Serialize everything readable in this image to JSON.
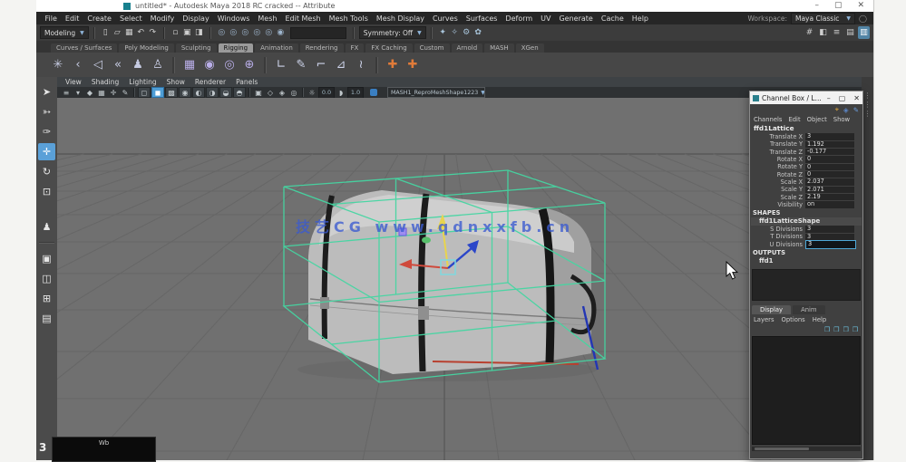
{
  "colors": {
    "lattice": "#45d6a2",
    "axis_x": "#cf4a3c",
    "axis_y": "#e8d44d",
    "axis_z": "#2b46c9",
    "watermark": "#3b5bd1",
    "accent": "#5285a6",
    "viewport_bg": "#707070"
  },
  "titlebar": {
    "title": "untitled* - Autodesk Maya 2018 RC cracked -- Attribute",
    "minimize": "–",
    "maximize": "▢",
    "close": "✕"
  },
  "menubar": {
    "items": [
      "File",
      "Edit",
      "Create",
      "Select",
      "Modify",
      "Display",
      "Windows",
      "Mesh",
      "Edit Mesh",
      "Mesh Tools",
      "Mesh Display",
      "Curves",
      "Surfaces",
      "Deform",
      "UV",
      "Generate",
      "Cache",
      "Help"
    ],
    "workspace_label": "Workspace:",
    "workspace_value": "Maya Classic"
  },
  "statusline": {
    "menuset": "Modeling",
    "file_icons": [
      {
        "name": "new-scene-icon",
        "glyph": "▯"
      },
      {
        "name": "open-scene-icon",
        "glyph": "▱"
      },
      {
        "name": "save-scene-icon",
        "glyph": "▦"
      },
      {
        "name": "undo-icon",
        "glyph": "↶"
      },
      {
        "name": "redo-icon",
        "glyph": "↷"
      }
    ],
    "mask_icons": [
      {
        "name": "select-hierarchy-icon",
        "glyph": "▫"
      },
      {
        "name": "select-object-icon",
        "glyph": "▣"
      },
      {
        "name": "select-component-icon",
        "glyph": "◨"
      }
    ],
    "snap_icons": [
      {
        "name": "snap-to-grid-icon",
        "glyph": "◎",
        "color": "#9fb6ce"
      },
      {
        "name": "snap-to-curve-icon",
        "glyph": "◎",
        "color": "#9fb6ce"
      },
      {
        "name": "snap-to-point-icon",
        "glyph": "◎",
        "color": "#9fb6ce"
      },
      {
        "name": "snap-to-center-icon",
        "glyph": "◎",
        "color": "#9fb6ce"
      },
      {
        "name": "snap-to-viewplane-icon",
        "glyph": "◎",
        "color": "#9fb6ce"
      },
      {
        "name": "make-live-icon",
        "glyph": "◉",
        "color": "#9fb6ce"
      }
    ],
    "symmetry": "Symmetry: Off",
    "render_icons": [
      {
        "name": "render-current-frame-icon",
        "glyph": "✦",
        "color": "#a8c4da"
      },
      {
        "name": "ipr-render-icon",
        "glyph": "✧",
        "color": "#a8c4da"
      },
      {
        "name": "render-settings-icon",
        "glyph": "⚙",
        "color": "#a8c4da"
      },
      {
        "name": "paint-effects-icon",
        "glyph": "✿",
        "color": "#a8c4da"
      }
    ],
    "right_icons": [
      {
        "name": "grid-toggle-icon",
        "glyph": "#"
      },
      {
        "name": "modeling-toolkit-icon",
        "glyph": "◧"
      },
      {
        "name": "hypershade-icon",
        "glyph": "≡"
      },
      {
        "name": "attribute-editor-icon",
        "glyph": "▤"
      },
      {
        "name": "channel-box-icon",
        "glyph": "▥",
        "active": true
      }
    ]
  },
  "shelf": {
    "tabs": [
      {
        "label": "Curves / Surfaces"
      },
      {
        "label": "Poly Modeling"
      },
      {
        "label": "Sculpting"
      },
      {
        "label": "Rigging",
        "active": true
      },
      {
        "label": "Animation"
      },
      {
        "label": "Rendering"
      },
      {
        "label": "FX"
      },
      {
        "label": "FX Caching"
      },
      {
        "label": "Custom"
      },
      {
        "label": "Arnold"
      },
      {
        "label": "MASH"
      },
      {
        "label": "XGen"
      }
    ],
    "icons": [
      {
        "name": "create-joint-icon",
        "glyph": "✳"
      },
      {
        "name": "ik-handle-icon",
        "glyph": "‹"
      },
      {
        "name": "ik-spline-icon",
        "glyph": "◁"
      },
      {
        "name": "insert-joint-icon",
        "glyph": "«"
      },
      {
        "name": "bind-skin-icon",
        "glyph": "♟"
      },
      {
        "name": "interactive-bind-icon",
        "glyph": "♙"
      },
      {
        "sep": true
      },
      {
        "name": "lattice-deformer-icon",
        "glyph": "▦",
        "color": "#b9aee8"
      },
      {
        "name": "cluster-deformer-icon",
        "glyph": "◉",
        "color": "#b9aee8"
      },
      {
        "name": "sculpt-deformer-icon",
        "glyph": "◎",
        "color": "#b9aee8"
      },
      {
        "name": "wrap-deformer-icon",
        "glyph": "⊕",
        "color": "#b9aee8"
      },
      {
        "sep": true
      },
      {
        "name": "edit-curve-icon",
        "glyph": "∟",
        "color": "#cdd3ea"
      },
      {
        "name": "pencil-curve-icon",
        "glyph": "✎",
        "color": "#cdd3ea"
      },
      {
        "name": "attach-curve-icon",
        "glyph": "⌐",
        "color": "#cdd3ea"
      },
      {
        "name": "detach-curve-icon",
        "glyph": "⊿",
        "color": "#cdd3ea"
      },
      {
        "name": "project-curve-icon",
        "glyph": "≀",
        "color": "#cdd3ea"
      },
      {
        "sep": true
      },
      {
        "name": "locator-icon",
        "glyph": "✚",
        "color": "#e07b39"
      },
      {
        "name": "annotation-icon",
        "glyph": "✚",
        "color": "#e07b39"
      }
    ]
  },
  "toolbox": {
    "tools": [
      {
        "name": "select-tool-icon",
        "glyph": "➤"
      },
      {
        "name": "lasso-tool-icon",
        "glyph": "➳"
      },
      {
        "name": "paint-select-tool-icon",
        "glyph": "✑"
      },
      {
        "name": "move-tool-icon",
        "glyph": "✛",
        "active": true
      },
      {
        "name": "rotate-tool-icon",
        "glyph": "↻"
      },
      {
        "name": "scale-tool-icon",
        "glyph": "⊡"
      }
    ],
    "extra": [
      {
        "name": "character-set-icon",
        "glyph": "♟"
      }
    ],
    "layouts": [
      {
        "name": "single-pane-layout-icon",
        "glyph": "▣"
      },
      {
        "name": "two-pane-layout-icon",
        "glyph": "◫"
      },
      {
        "name": "four-pane-layout-icon",
        "glyph": "⊞"
      },
      {
        "name": "outliner-pane-layout-icon",
        "glyph": "▤"
      }
    ]
  },
  "viewport": {
    "menus": [
      "View",
      "Shading",
      "Lighting",
      "Show",
      "Renderer",
      "Panels"
    ],
    "toolbar_icons": [
      {
        "name": "pane-menu-icon",
        "glyph": "≡"
      },
      {
        "name": "camera-select-icon",
        "glyph": "▾"
      },
      {
        "name": "bookmark-icon",
        "glyph": "◆"
      },
      {
        "name": "image-plane-icon",
        "glyph": "▦"
      },
      {
        "name": "2d-pan-zoom-icon",
        "glyph": "✛"
      },
      {
        "name": "grease-pencil-icon",
        "glyph": "✎"
      },
      {
        "sep": true
      },
      {
        "name": "wireframe-mode-icon",
        "glyph": "◻",
        "boxed": true
      },
      {
        "name": "shaded-mode-icon",
        "glyph": "◼",
        "boxed": true,
        "active": true
      },
      {
        "name": "textured-mode-icon",
        "glyph": "▩",
        "boxed": true
      },
      {
        "name": "use-all-lights-icon",
        "glyph": "◉",
        "boxed": true
      },
      {
        "name": "shadows-icon",
        "glyph": "◐",
        "boxed": true
      },
      {
        "name": "screen-ao-icon",
        "glyph": "◑",
        "boxed": true
      },
      {
        "name": "motion-blur-icon",
        "glyph": "◒",
        "boxed": true
      },
      {
        "name": "anti-aliasing-icon",
        "glyph": "◓",
        "boxed": true
      },
      {
        "sep": true
      },
      {
        "name": "isolate-select-icon",
        "glyph": "▣"
      },
      {
        "name": "xray-icon",
        "glyph": "◇"
      },
      {
        "name": "xray-joints-icon",
        "glyph": "◈"
      },
      {
        "name": "selection-highlight-icon",
        "glyph": "◎"
      },
      {
        "sep": true
      },
      {
        "name": "exposure-icon",
        "glyph": "☼"
      },
      {
        "name": "exposure-value",
        "glyph": "0.0",
        "chip": true
      },
      {
        "name": "gamma-icon",
        "glyph": "◗"
      },
      {
        "name": "gamma-value",
        "glyph": "1.0",
        "chip": true
      }
    ],
    "object_dropdown": "MASH1_ReproMeshShape1223",
    "watermark": "技艺CG  www.qdnxxfb.cn",
    "frame_label": "3",
    "overlay_label": "Wb"
  },
  "channel_box": {
    "window_title": "Channel Box / L...",
    "minimize": "–",
    "maximize": "▢",
    "close": "✕",
    "corner_icons": [
      {
        "name": "manip-slow-icon",
        "glyph": "⌖",
        "color": "#d8a23c"
      },
      {
        "name": "manip-medium-icon",
        "glyph": "◈",
        "color": "#5b86c8"
      },
      {
        "name": "manip-fast-icon",
        "glyph": "✎",
        "color": "#6a9ad8"
      }
    ],
    "menus": [
      "Channels",
      "Edit",
      "Object",
      "Show"
    ],
    "object_name": "ffd1Lattice",
    "transform_rows": [
      {
        "label": "Translate X",
        "value": "3"
      },
      {
        "label": "Translate Y",
        "value": "1.192"
      },
      {
        "label": "Translate Z",
        "value": "-0.177"
      },
      {
        "label": "Rotate X",
        "value": "0"
      },
      {
        "label": "Rotate Y",
        "value": "0"
      },
      {
        "label": "Rotate Z",
        "value": "0"
      },
      {
        "label": "Scale X",
        "value": "2.037"
      },
      {
        "label": "Scale Y",
        "value": "2.071"
      },
      {
        "label": "Scale Z",
        "value": "2.19"
      },
      {
        "label": "Visibility",
        "value": "on"
      }
    ],
    "shapes_header": "SHAPES",
    "shape_name": "ffd1LatticeShape",
    "shape_rows": [
      {
        "label": "S Divisions",
        "value": "3"
      },
      {
        "label": "T Divisions",
        "value": "3"
      },
      {
        "label": "U Divisions",
        "value": "3",
        "editing": true
      }
    ],
    "outputs_header": "OUTPUTS",
    "output_node": "ffd1",
    "layer_editor": {
      "tabs": [
        {
          "label": "Display",
          "active": true
        },
        {
          "label": "Anim"
        }
      ],
      "menus": [
        "Layers",
        "Options",
        "Help"
      ],
      "icons": [
        {
          "name": "layer-new-icon",
          "glyph": "❒"
        },
        {
          "name": "layer-new-selected-icon",
          "glyph": "❒"
        },
        {
          "name": "layer-move-up-icon",
          "glyph": "❒"
        },
        {
          "name": "layer-move-down-icon",
          "glyph": "❒"
        }
      ]
    }
  }
}
